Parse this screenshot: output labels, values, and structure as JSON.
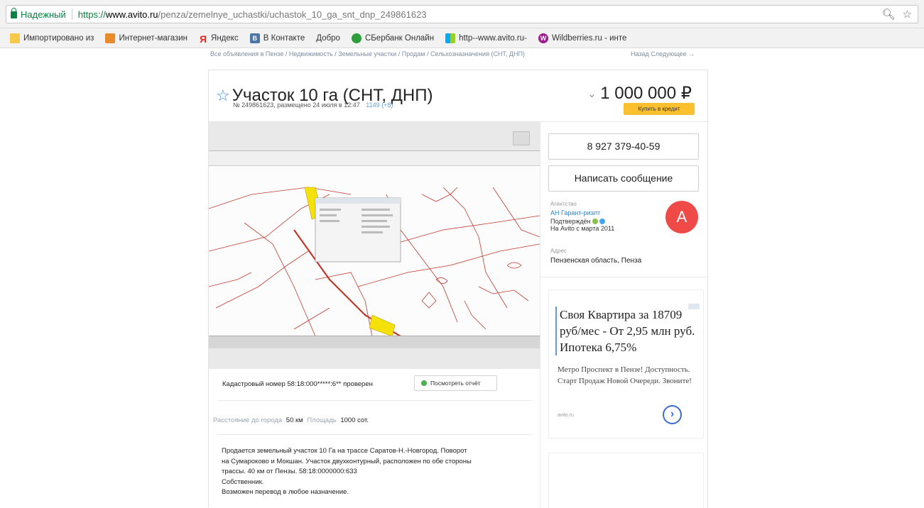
{
  "browser": {
    "secure_label": "Надежный",
    "url_scheme": "https://",
    "url_host": "www.avito.ru",
    "url_path": "/penza/zemelnye_uchastki/uchastok_10_ga_snt_dnp_249861623",
    "icons": [
      "zoom-icon",
      "bookmark-star-icon"
    ]
  },
  "bookmarks": [
    {
      "label": "Импортировано из",
      "icon": "folder-icon"
    },
    {
      "label": "Интернет-магазин",
      "icon": "shop-icon"
    },
    {
      "label": "Яндекс",
      "icon": "yandex-icon"
    },
    {
      "label": "В Контакте",
      "icon": "vk-icon"
    },
    {
      "label": "Добро",
      "icon": ""
    },
    {
      "label": "СБербанк Онлайн",
      "icon": "sberbank-icon"
    },
    {
      "label": "http--www.avito.ru-",
      "icon": "avito-icon"
    },
    {
      "label": "Wildberries.ru - инте",
      "icon": "wildberries-icon"
    }
  ],
  "page": {
    "breadcrumbs": "Все объявления в Пензе / Недвижимость / Земельные участки / Продам / Сельхозназначения (СНТ, ДНП)",
    "nav_links": "Назад  Следующее →",
    "title": "Участок 10 га (СНТ, ДНП)",
    "meta": "№ 249861623, размещено 24 июля в 12:47",
    "views": "1149 (+8)",
    "price": "1 000 000 ₽",
    "credit_button": "Купить в кредит",
    "phone_button": "8 927 379-40-59",
    "message_button": "Написать сообщение",
    "seller": {
      "type_label": "Агентство",
      "name": "АН Гарант-риэлт",
      "verified": "Подтверждён",
      "since": "На Avito с марта 2011",
      "avatar_letter": "A",
      "address_label": "Адрес",
      "address": "Пензенская область, Пенза"
    },
    "ad": {
      "headline": "Своя Квартира за 18709 руб/мес - От 2,95 млн руб. Ипотека 6,75%",
      "text": "Метро Проспект в Пензе! Доступность. Старт Продаж Новой Очереди. Звоните!",
      "domain": "avito.ru"
    },
    "cadastral": "Кадастровый номер 58:18:000*****:6** проверен",
    "report_button": "Посмотреть отчёт",
    "params": {
      "distance_label": "Расстояние до города",
      "distance_value": "50 км",
      "area_label": "Площадь",
      "area_value": "1000 сот."
    },
    "description": [
      "Продается земельный участок 10 Га на трассе Саратов-Н.-Новгород. Поворот",
      "на Сумароково и Мокшан. Участок двухконтурный, расположен по обе стороны",
      "трассы. 40 км от Пензы. 58:18:0000000:633",
      "Собственник.",
      "Возможен перевод в любое назначение."
    ]
  },
  "colors": {
    "secure_green": "#0b8043",
    "link_blue": "#2d7ed2",
    "credit_yellow": "#fbc02d",
    "avatar_red": "#ef4a47",
    "map_line": "#c0392b",
    "parcel_yellow": "#f5e10a"
  }
}
